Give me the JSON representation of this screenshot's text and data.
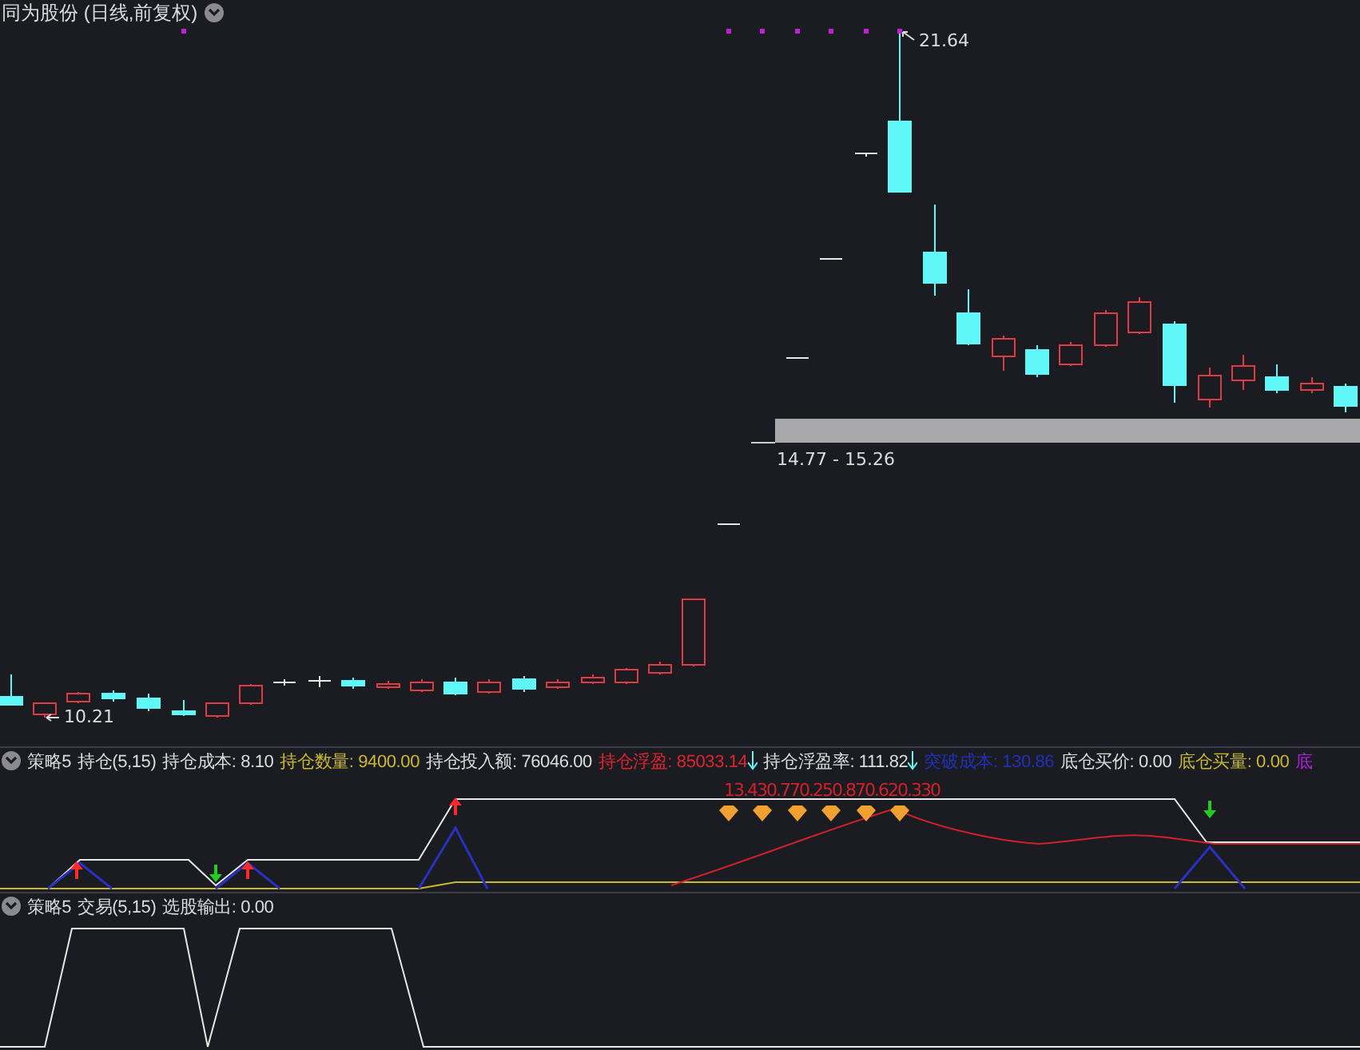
{
  "chart": {
    "title": "同为股份 (日线,前复权)",
    "labels": [
      {
        "kind": "high",
        "text": "21.64"
      },
      {
        "kind": "low",
        "text": "10.21"
      },
      {
        "kind": "range",
        "text": "14.77 - 15.26"
      }
    ]
  },
  "indicator_panels": [
    {
      "kind": "position",
      "name": "策略5",
      "params": "持仓(5,15)",
      "overlay_text": "13.430.770.250.870.620.330",
      "fields": [
        {
          "label": "持仓成本:",
          "value": "8.10",
          "color": "#dcdcdc",
          "arrow_down": false
        },
        {
          "label": "持仓数量:",
          "value": "9400.00",
          "color": "#c8b832",
          "arrow_down": false
        },
        {
          "label": "持仓投入额:",
          "value": "76046.00",
          "color": "#dcdcdc",
          "arrow_down": false
        },
        {
          "label": "持仓浮盈:",
          "value": "85033.14",
          "color": "#e0242c",
          "arrow_down": true
        },
        {
          "label": "持仓浮盈率:",
          "value": "111.82",
          "color": "#dcdcdc",
          "arrow_down": true
        },
        {
          "label": "突破成本:",
          "value": "130.86",
          "color": "#2130b8",
          "arrow_down": false
        },
        {
          "label": "底仓买价:",
          "value": "0.00",
          "color": "#dcdcdc",
          "arrow_down": false
        },
        {
          "label": "底仓买量:",
          "value": "0.00",
          "color": "#c8b832",
          "arrow_down": false
        },
        {
          "label": "底",
          "color": "#b020d8",
          "arrow_down": false
        }
      ]
    },
    {
      "kind": "trade",
      "name": "策略5",
      "params": "交易(5,15)",
      "fields": [
        {
          "label": "选股输出:",
          "value": "0.00",
          "color": "#dcdcdc",
          "arrow_down": false
        }
      ]
    }
  ]
}
